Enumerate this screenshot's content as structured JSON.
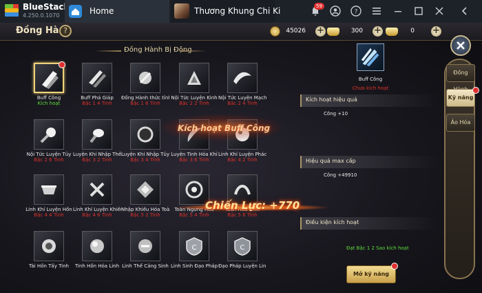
{
  "app": {
    "name": "BlueStacks",
    "version": "4.250.0.1070",
    "tabs": [
      {
        "label": "Home"
      },
      {
        "label": "Thương Khung Chi Ki"
      }
    ],
    "notification_count": "59"
  },
  "game": {
    "title": "Đồng Hành",
    "help_label": "?",
    "currencies": [
      {
        "icon": "coin-icon",
        "value": "45026"
      },
      {
        "icon": "gold-ingot-icon",
        "value": "300"
      },
      {
        "icon": "gold-ingot-icon",
        "value": "0"
      }
    ],
    "section_title": "Đồng Hành Bị Động",
    "skills": [
      {
        "name": "Buff Công",
        "status": "Kích hoạt",
        "active": true,
        "selected": true
      },
      {
        "name": "Buff Phá Giáp",
        "status": "Bậc 1 4 Tinh"
      },
      {
        "name": "Đồng Hành thức tỉnh",
        "status": "Bậc 1 6 Tinh"
      },
      {
        "name": "Nội Tức Luyện Kinh",
        "status": "Bậc 2 2 Tinh"
      },
      {
        "name": "Nội Tức Luyện Mạch",
        "status": "Bậc 2 4 Tinh"
      },
      {
        "name": "Nội Tức Luyện Tủy",
        "status": "Bậc 2 6 Tinh"
      },
      {
        "name": "Luyện Khí Nhập Thể",
        "status": "Bậc 3 2 Tinh"
      },
      {
        "name": "Luyện Khí Nhập Tủy",
        "status": "Bậc 3 4 Tinh"
      },
      {
        "name": "Luyện Tinh Hóa Khí",
        "status": "Bậc 3 6 Tinh"
      },
      {
        "name": "Linh Khí Luyện Phách",
        "status": "Bậc 4 2 Tinh"
      },
      {
        "name": "Linh Khí Luyện Hồn",
        "status": "Bậc 4 4 Tinh"
      },
      {
        "name": "Linh Khí Luyện Khiếu",
        "status": "Bậc 4 6 Tinh"
      },
      {
        "name": "Nhập Khiếu Hóa Toàn",
        "status": "Bậc 5 2 Tinh"
      },
      {
        "name": "Toàn Ngưng Hoa",
        "status": "Bậc 5 4 Tinh"
      },
      {
        "name": "Toàn Hóa Kinh",
        "status": "Bậc 5 6 Tinh"
      },
      {
        "name": "Tài Hồn Tẩy Tinh",
        "status": ""
      },
      {
        "name": "Tinh Hồn Hóa Linh",
        "status": ""
      },
      {
        "name": "Linh Thể Cảng Sinh",
        "status": ""
      },
      {
        "name": "Linh Sinh Đạo Pháp",
        "status": ""
      },
      {
        "name": "Đạo Pháp Luyện Linh",
        "status": ""
      }
    ],
    "effects": {
      "activate_text": "Kích hoạt Buff Công",
      "combat_power": "Chiến Lực: +770"
    },
    "detail": {
      "skill_name": "Buff Công",
      "skill_status": "Chưa kích hoạt",
      "activate_effect_label": "Kích hoạt hiệu quả",
      "activate_effect_value": "Công +10",
      "max_effect_label": "Hiệu quả max cấp",
      "max_effect_value": "Công +49910",
      "condition_label": "Điều kiện kích hoạt",
      "condition_value": "Đạt Bậc 1 2 Sao kích hoạt",
      "unlock_button": "Mở kỹ năng"
    },
    "side_tabs": [
      {
        "label": "Đồng Hành",
        "active": false
      },
      {
        "label": "Kỹ năng",
        "active": true
      },
      {
        "label": "Ảo Hóa",
        "active": false
      }
    ],
    "colors": {
      "gold": "#f0d27a",
      "active_green": "#5ddf3c",
      "locked_red": "#e0322c",
      "badge_red": "#e0302f"
    }
  }
}
